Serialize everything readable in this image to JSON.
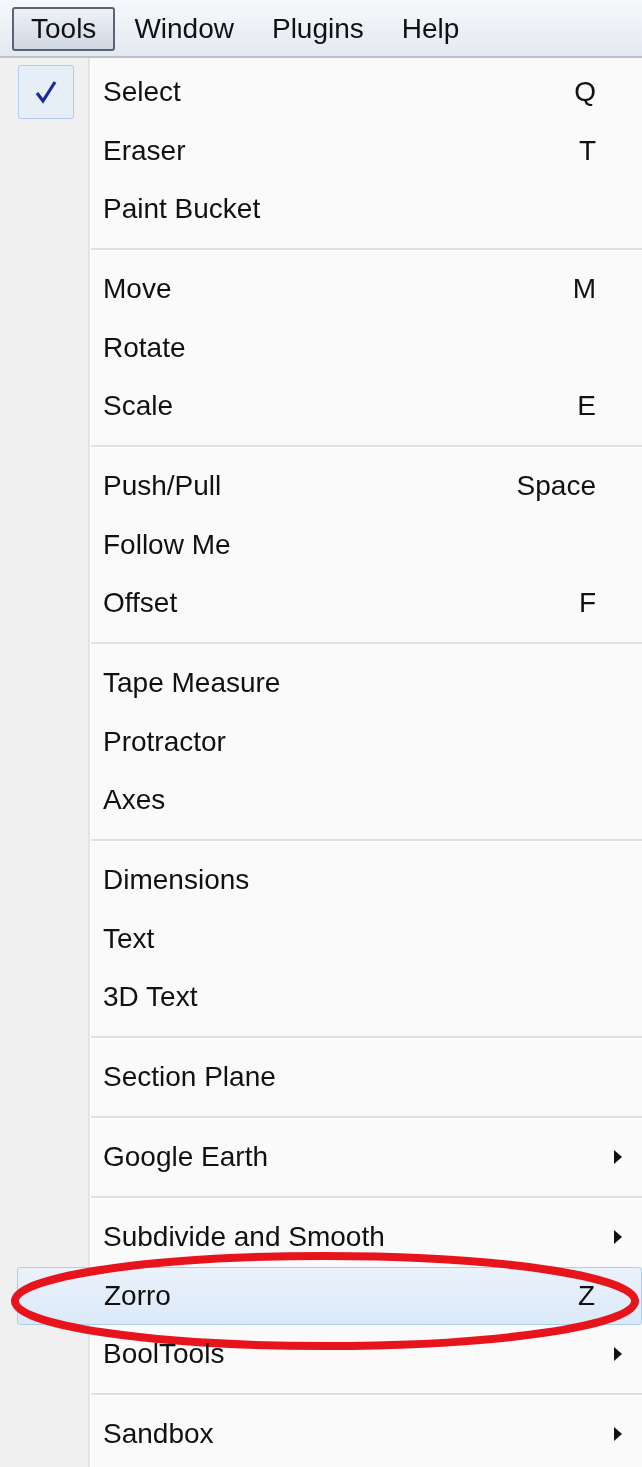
{
  "menubar": [
    {
      "label": "Tools",
      "selected": true
    },
    {
      "label": "Window",
      "selected": false
    },
    {
      "label": "Plugins",
      "selected": false
    },
    {
      "label": "Help",
      "selected": false
    }
  ],
  "menu": {
    "groups": [
      [
        {
          "label": "Select",
          "shortcut": "Q",
          "checked": true,
          "submenu": false,
          "selected": false,
          "circled": false
        },
        {
          "label": "Eraser",
          "shortcut": "T",
          "checked": false,
          "submenu": false,
          "selected": false,
          "circled": false
        },
        {
          "label": "Paint Bucket",
          "checked": false,
          "submenu": false,
          "selected": false,
          "circled": false
        }
      ],
      [
        {
          "label": "Move",
          "shortcut": "M",
          "checked": false,
          "submenu": false,
          "selected": false,
          "circled": false
        },
        {
          "label": "Rotate",
          "checked": false,
          "submenu": false,
          "selected": false,
          "circled": false
        },
        {
          "label": "Scale",
          "shortcut": "E",
          "checked": false,
          "submenu": false,
          "selected": false,
          "circled": false
        }
      ],
      [
        {
          "label": "Push/Pull",
          "shortcut": "Space",
          "checked": false,
          "submenu": false,
          "selected": false,
          "circled": false
        },
        {
          "label": "Follow Me",
          "checked": false,
          "submenu": false,
          "selected": false,
          "circled": false
        },
        {
          "label": "Offset",
          "shortcut": "F",
          "checked": false,
          "submenu": false,
          "selected": false,
          "circled": false
        }
      ],
      [
        {
          "label": "Tape Measure",
          "checked": false,
          "submenu": false,
          "selected": false,
          "circled": false
        },
        {
          "label": "Protractor",
          "checked": false,
          "submenu": false,
          "selected": false,
          "circled": false
        },
        {
          "label": "Axes",
          "checked": false,
          "submenu": false,
          "selected": false,
          "circled": false
        }
      ],
      [
        {
          "label": "Dimensions",
          "checked": false,
          "submenu": false,
          "selected": false,
          "circled": false
        },
        {
          "label": "Text",
          "checked": false,
          "submenu": false,
          "selected": false,
          "circled": false
        },
        {
          "label": "3D Text",
          "checked": false,
          "submenu": false,
          "selected": false,
          "circled": false
        }
      ],
      [
        {
          "label": "Section Plane",
          "checked": false,
          "submenu": false,
          "selected": false,
          "circled": false
        }
      ],
      [
        {
          "label": "Google Earth",
          "checked": false,
          "submenu": true,
          "selected": false,
          "circled": false
        }
      ],
      [
        {
          "label": "Subdivide and Smooth",
          "checked": false,
          "submenu": true,
          "selected": false,
          "circled": false
        },
        {
          "label": "Zorro",
          "shortcut": "Z",
          "checked": false,
          "submenu": false,
          "selected": true,
          "circled": true
        },
        {
          "label": "BoolTools",
          "checked": false,
          "submenu": true,
          "selected": false,
          "circled": false
        }
      ],
      [
        {
          "label": "Sandbox",
          "checked": false,
          "submenu": true,
          "selected": false,
          "circled": false
        }
      ]
    ]
  }
}
